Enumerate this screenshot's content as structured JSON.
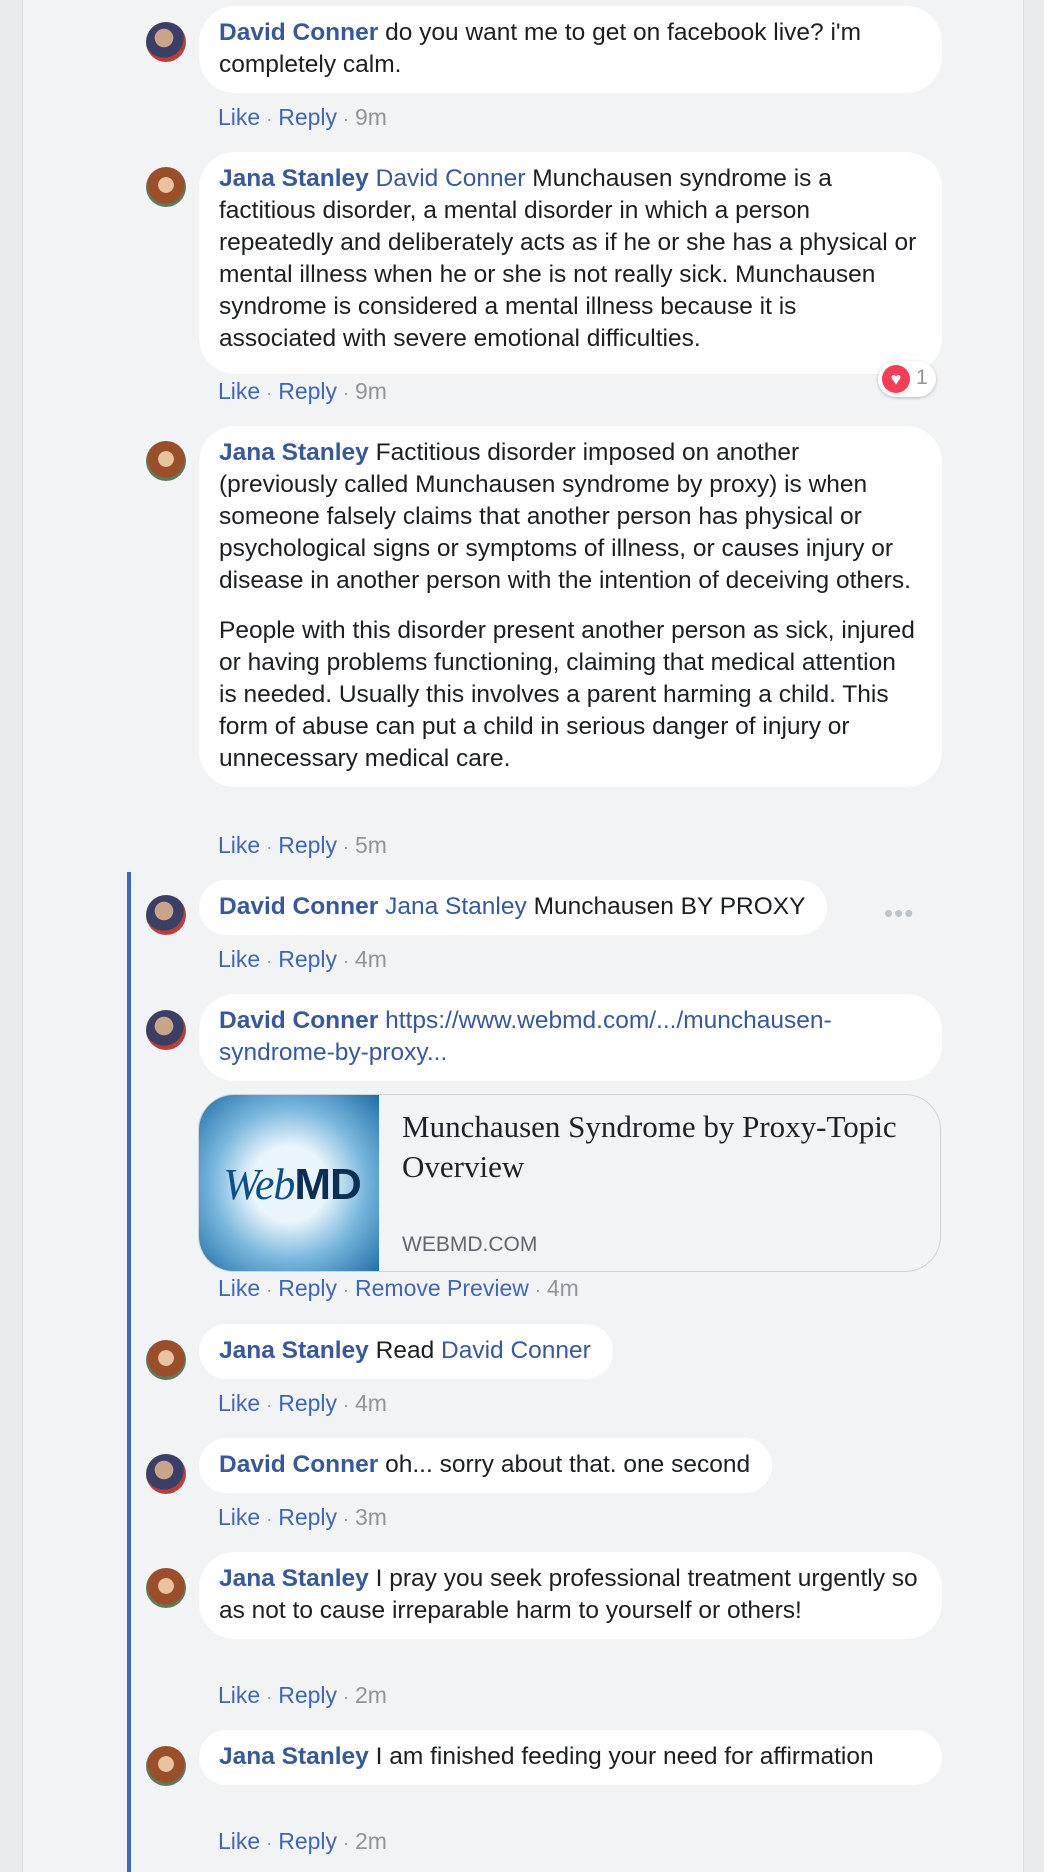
{
  "action_labels": {
    "like": "Like",
    "reply": "Reply",
    "remove_preview": "Remove Preview"
  },
  "comments": [
    {
      "author": "David Conner",
      "mention": "",
      "paragraphs": [
        "do you want me to get on facebook live? i'm completely calm."
      ],
      "time": "9m"
    },
    {
      "author": "Jana Stanley",
      "mention": "David Conner",
      "paragraphs": [
        "Munchausen syndrome is a factitious disorder, a mental disorder in which a person repeatedly and deliberately acts as if he or she has a physical or mental illness when he or she is not really sick. Munchausen syndrome is considered a mental illness because it is associated with severe emotional difficulties."
      ],
      "time": "9m",
      "reaction": {
        "icon": "heart-icon",
        "count": "1"
      }
    },
    {
      "author": "Jana Stanley",
      "mention": "",
      "paragraphs": [
        "Factitious disorder imposed on another (previously called Munchausen syndrome by proxy) is when someone falsely claims that another person has physical or psychological signs or symptoms of illness, or causes injury or disease in another person with the intention of deceiving others.",
        "People with this disorder present another person as sick, injured or having problems functioning, claiming that medical attention is needed. Usually this involves a parent harming a child. This form of abuse can put a child in serious danger of injury or unnecessary medical care."
      ],
      "time": "5m"
    },
    {
      "author": "David Conner",
      "mention": "Jana Stanley",
      "paragraphs": [
        "Munchausen BY PROXY"
      ],
      "time": "4m",
      "more_icon": "more-horizontal-icon"
    },
    {
      "author": "David Conner",
      "mention": "",
      "link": "https://www.webmd.com/.../munchausen-syndrome-by-proxy...",
      "time": "4m",
      "link_preview": {
        "title": "Munchausen Syndrome by Proxy-Topic Overview",
        "domain": "WEBMD.COM",
        "logo_web": "Web",
        "logo_md": "MD"
      }
    },
    {
      "author": "Jana Stanley",
      "mention": "",
      "text_before_mention": "Read",
      "mention_after": "David Conner",
      "time": "4m"
    },
    {
      "author": "David Conner",
      "mention": "",
      "paragraphs": [
        "oh... sorry about that. one second"
      ],
      "time": "3m"
    },
    {
      "author": "Jana Stanley",
      "mention": "",
      "paragraphs": [
        "I pray you seek professional treatment urgently so as not to cause irreparable harm to yourself or others!"
      ],
      "time": "2m"
    },
    {
      "author": "Jana Stanley",
      "mention": "",
      "paragraphs": [
        "I am finished feeding your need for affirmation"
      ],
      "time": "2m"
    }
  ],
  "colors": {
    "link_blue": "#385898",
    "action_blue": "#4267b2",
    "thread_line": "#4267b2",
    "heart": "#f33e58"
  }
}
